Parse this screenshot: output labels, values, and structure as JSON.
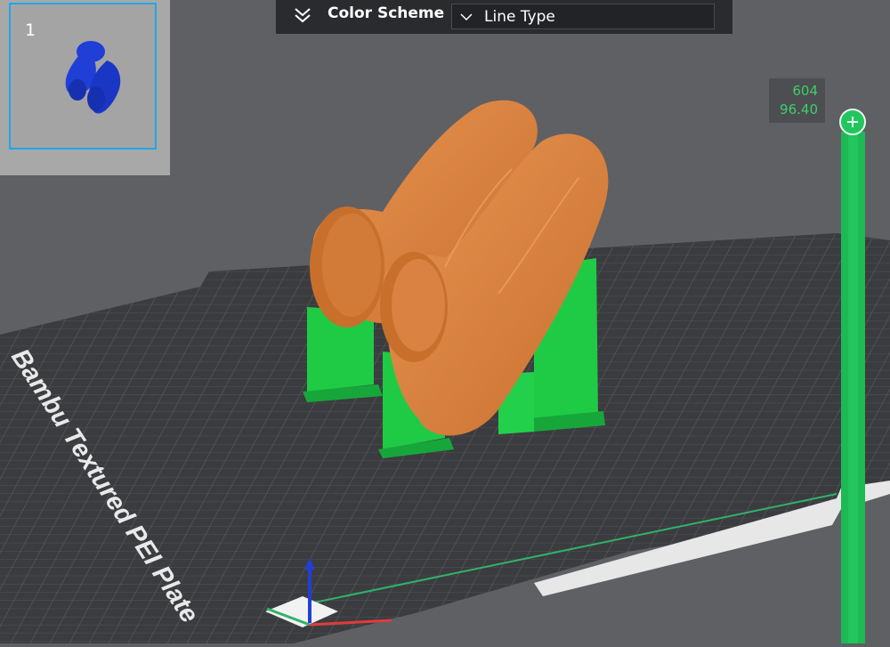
{
  "toolbar": {
    "color_scheme_label": "Color Scheme",
    "selected_scheme": "Line Type"
  },
  "plate_panel": {
    "plate_number": "1"
  },
  "bed": {
    "plate_label": "Bambu Textured PEI Plate"
  },
  "layer_slider": {
    "layer": "604",
    "height": "96.40"
  },
  "colors": {
    "model": "#d9803f",
    "support": "#22c55e",
    "thumbnail_model": "#1f3fd6",
    "selection": "#1ea7e8",
    "slider": "#22c55e"
  },
  "icons": [
    "double-chevron-down-icon",
    "chevron-down-icon",
    "plus-icon",
    "axis-gizmo-icon"
  ]
}
